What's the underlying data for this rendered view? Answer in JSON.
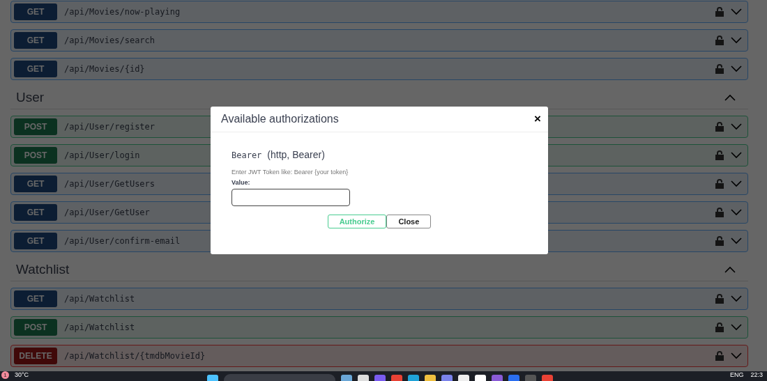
{
  "sections": [
    {
      "endpoints": [
        {
          "method": "GET",
          "path": "/api/Movies/now-playing"
        },
        {
          "method": "GET",
          "path": "/api/Movies/search"
        },
        {
          "method": "GET",
          "path": "/api/Movies/{id}"
        }
      ]
    },
    {
      "title": "User",
      "expanded": true,
      "endpoints": [
        {
          "method": "POST",
          "path": "/api/User/register"
        },
        {
          "method": "POST",
          "path": "/api/User/login"
        },
        {
          "method": "GET",
          "path": "/api/User/GetUsers"
        },
        {
          "method": "GET",
          "path": "/api/User/GetUser"
        },
        {
          "method": "GET",
          "path": "/api/User/confirm-email"
        }
      ]
    },
    {
      "title": "Watchlist",
      "expanded": true,
      "endpoints": [
        {
          "method": "GET",
          "path": "/api/Watchlist"
        },
        {
          "method": "POST",
          "path": "/api/Watchlist"
        },
        {
          "method": "DELETE",
          "path": "/api/Watchlist/{tmdbMovieId}"
        }
      ]
    }
  ],
  "modal": {
    "title": "Available authorizations",
    "close": "×",
    "scheme_name": "Bearer",
    "scheme_type": "(http, Bearer)",
    "description": "Enter JWT Token like: Bearer {your token}",
    "value_label": "Value:",
    "buttons": [
      {
        "kind": "authorize",
        "label": "Authorize"
      },
      {
        "kind": "close",
        "label": "Close"
      }
    ]
  },
  "taskbar": {
    "notification_count": "1",
    "weather": "30°C",
    "language": "ENG",
    "clock": "22:3"
  }
}
